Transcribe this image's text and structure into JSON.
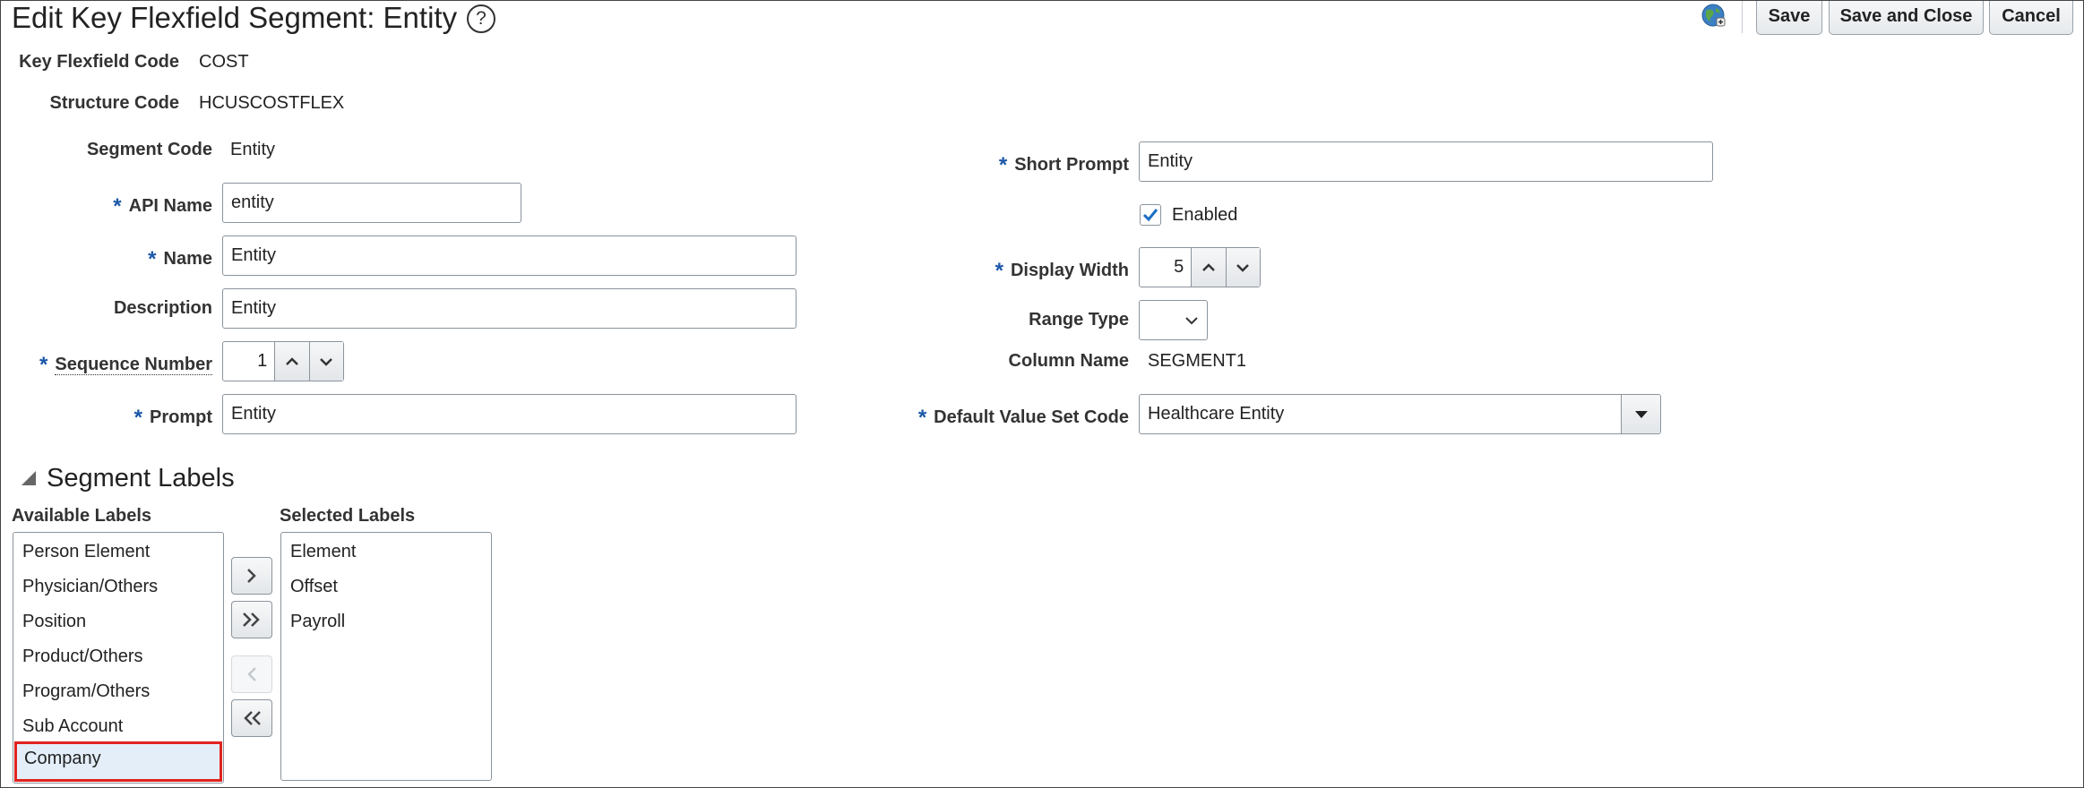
{
  "header": {
    "title": "Edit Key Flexfield Segment: Entity",
    "help_glyph": "?",
    "buttons": {
      "save_label": "Save",
      "save_close_label": "Save and Close",
      "cancel_label": "Cancel"
    }
  },
  "info": {
    "key_flexfield_code_label": "Key Flexfield Code",
    "key_flexfield_code_value": "COST",
    "structure_code_label": "Structure Code",
    "structure_code_value": "HCUSCOSTFLEX"
  },
  "form": {
    "required_marker": "*",
    "segment_code_label": "Segment Code",
    "segment_code_value": "Entity",
    "api_name_label": "API Name",
    "api_name_value": "entity",
    "name_label": "Name",
    "name_value": "Entity",
    "description_label": "Description",
    "description_value": "Entity",
    "sequence_number_label": "Sequence Number",
    "sequence_number_value": "1",
    "prompt_label": "Prompt",
    "prompt_value": "Entity",
    "short_prompt_label": "Short Prompt",
    "short_prompt_value": "Entity",
    "enabled_label": "Enabled",
    "enabled_checked": true,
    "display_width_label": "Display Width",
    "display_width_value": "5",
    "range_type_label": "Range Type",
    "range_type_value": "",
    "column_name_label": "Column Name",
    "column_name_value": "SEGMENT1",
    "default_value_set_code_label": "Default Value Set Code",
    "default_value_set_code_value": "Healthcare Entity"
  },
  "segment_labels": {
    "title": "Segment Labels",
    "available_title": "Available Labels",
    "selected_title": "Selected Labels",
    "available": [
      "Person Element",
      "Physician/Others",
      "Position",
      "Product/Others",
      "Program/Others",
      "Sub Account",
      "Company"
    ],
    "selected": [
      "Element",
      "Offset",
      "Payroll"
    ],
    "highlighted_available_index": 6
  },
  "colors": {
    "required": "#1a57a8",
    "highlight_border": "#e0231e",
    "highlight_fill": "#e3eef9",
    "checkmark": "#1a6fc4"
  },
  "icons": {
    "help": "help-icon",
    "globe": "globe-icon",
    "move": "chevron-right-icon",
    "move_all": "double-chevron-right-icon",
    "remove": "chevron-left-icon",
    "remove_all": "double-chevron-left-icon",
    "collapse": "collapse-triangle-icon"
  }
}
